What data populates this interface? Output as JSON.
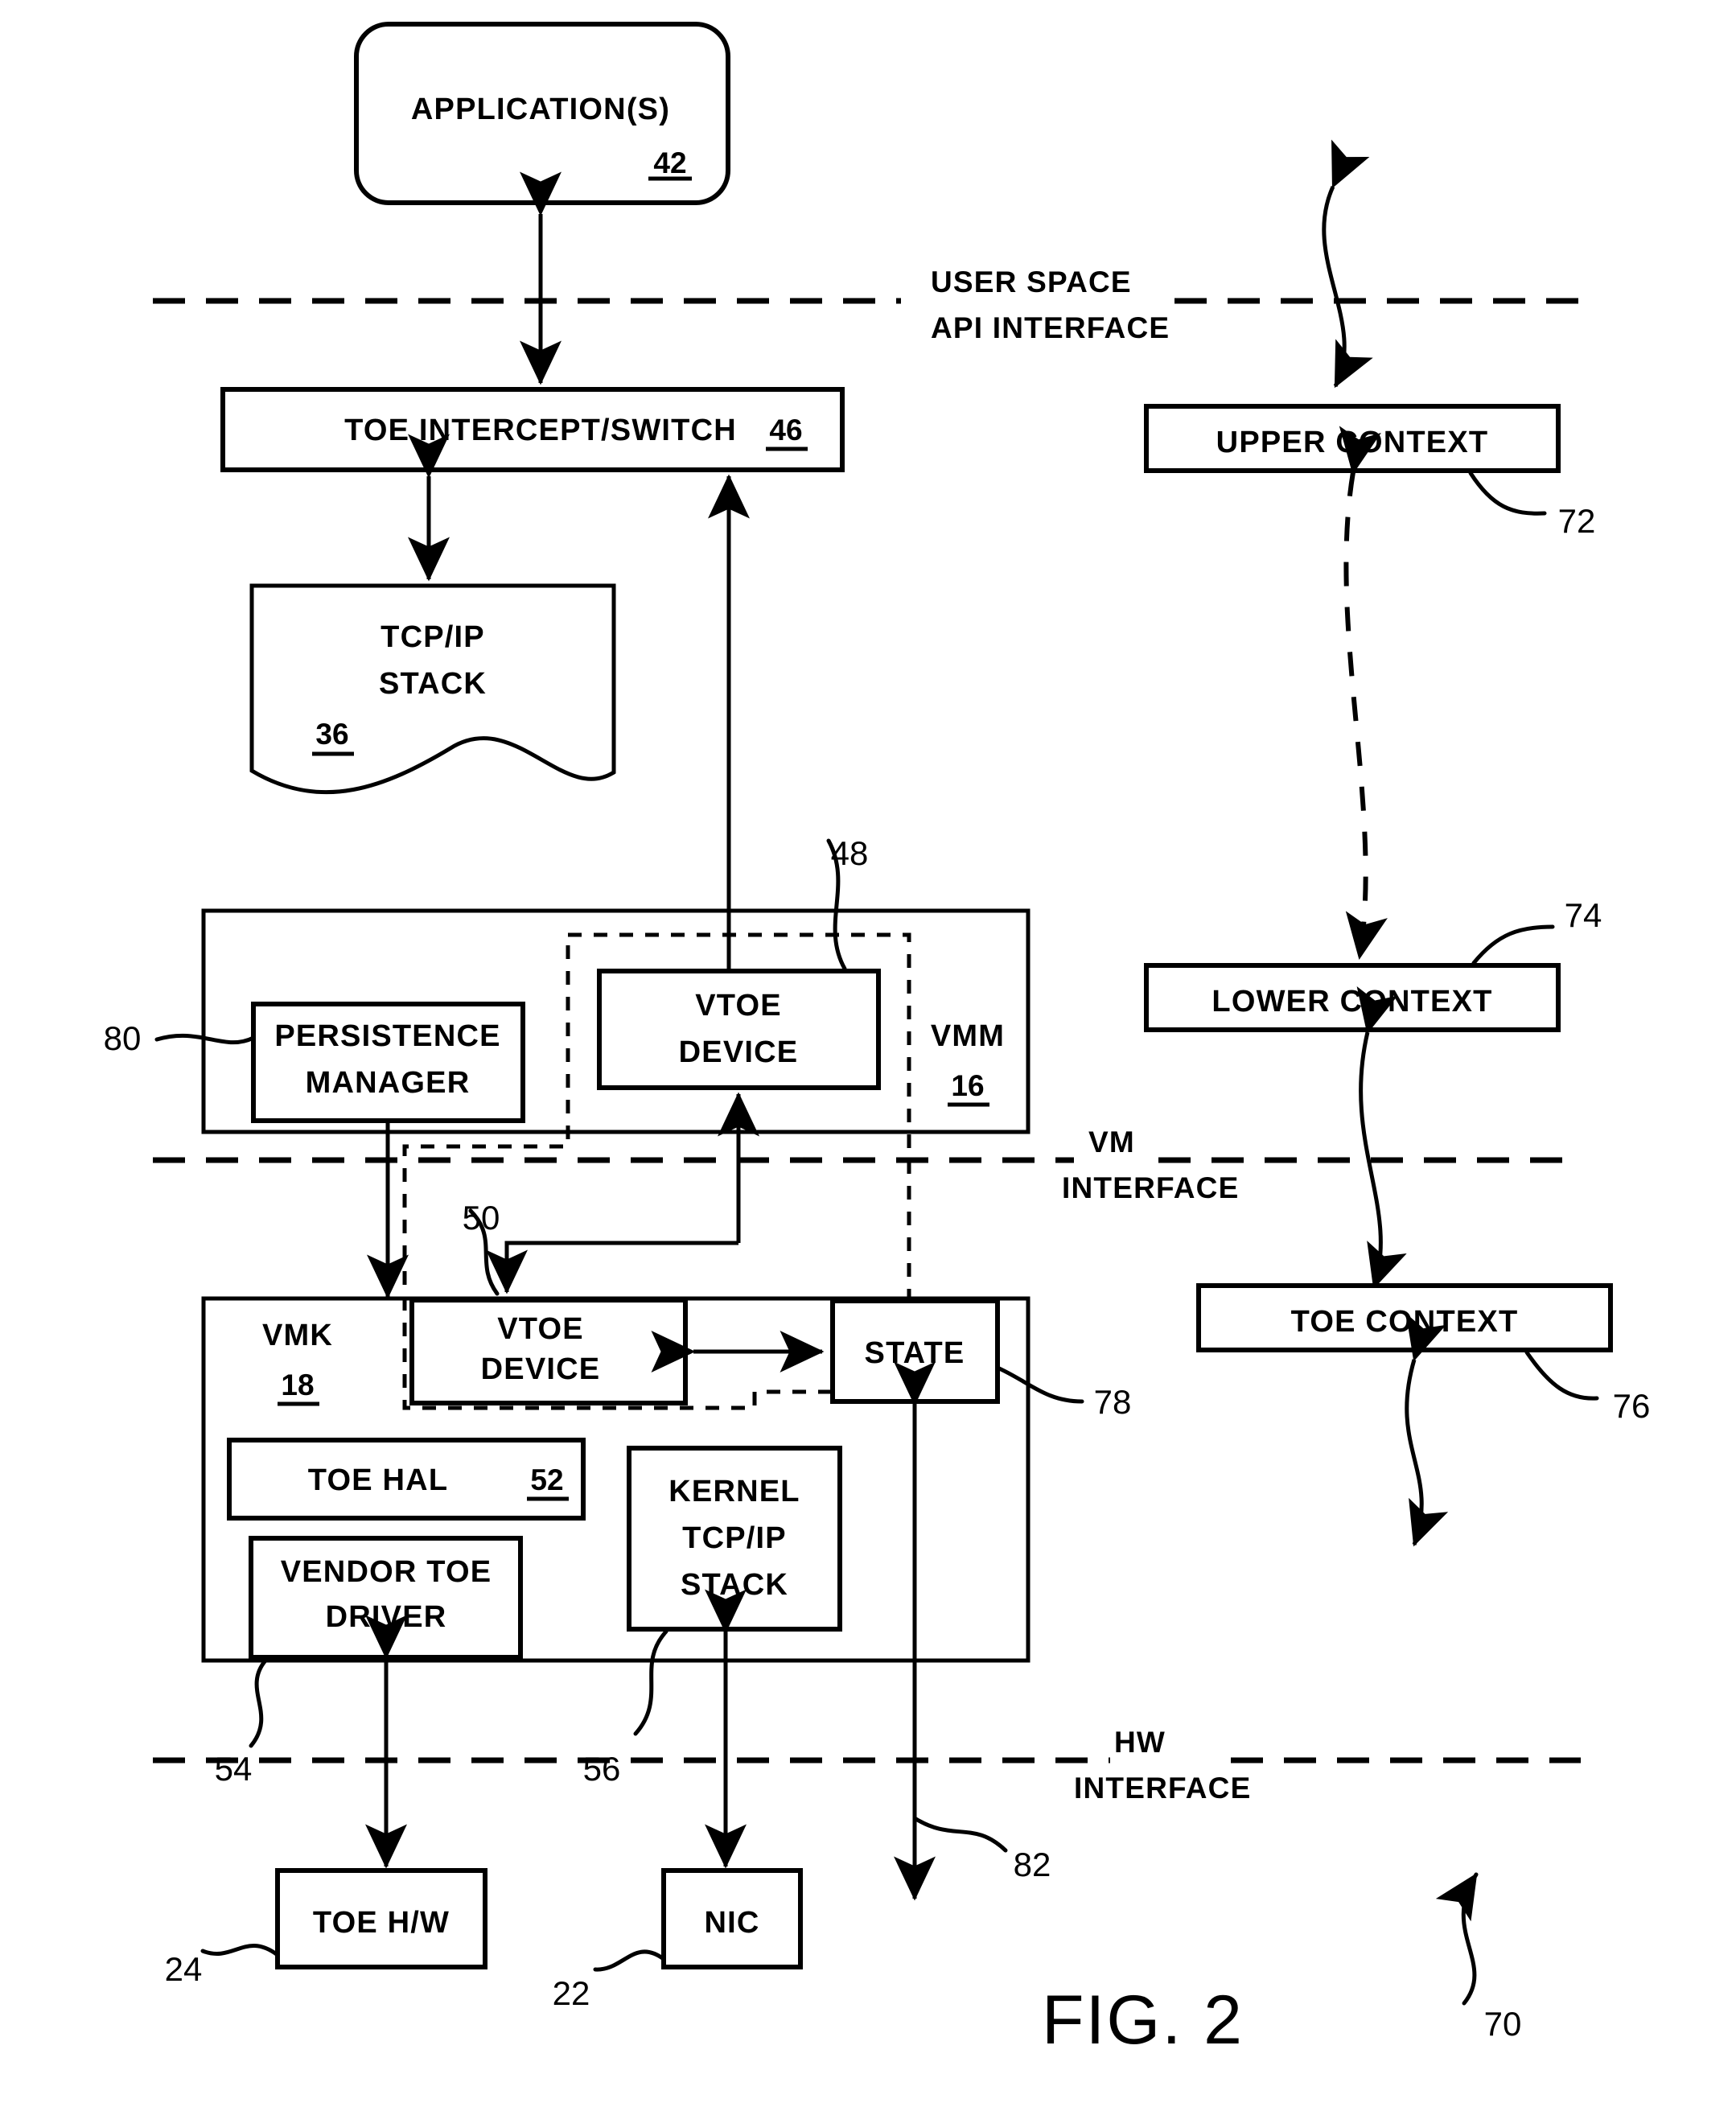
{
  "figure": {
    "label_main": "F",
    "label_rest": "IG",
    "label_full": "FIG. 2",
    "label_small": "IG. 2",
    "label_cap": "F",
    "ref": "70"
  },
  "interfaces": [
    {
      "id": "user-space",
      "line1": "USER SPACE",
      "line2": "API INTERFACE"
    },
    {
      "id": "vm",
      "line1": "VM",
      "line2": "INTERFACE"
    },
    {
      "id": "hw",
      "line1": "HW",
      "line2": "INTERFACE"
    }
  ],
  "blocks": {
    "application": {
      "label": "APPLICATION(S)",
      "ref": "42"
    },
    "toe_intercept": {
      "label": "TOE INTERCEPT/SWITCH",
      "ref": "46"
    },
    "tcpip_stack": {
      "line1": "TCP/IP",
      "line2": "STACK",
      "ref": "36"
    },
    "persistence_mgr": {
      "line1": "PERSISTENCE",
      "line2": "MANAGER",
      "ref": "80"
    },
    "vtoe_device_vmm": {
      "line1": "VTOE",
      "line2": "DEVICE",
      "ref": "48"
    },
    "vmm": {
      "label": "VMM",
      "ref": "16"
    },
    "vtoe_device_vmk": {
      "line1": "VTOE",
      "line2": "DEVICE",
      "ref": "50"
    },
    "vmk": {
      "label": "VMK",
      "ref": "18"
    },
    "state": {
      "label": "STATE",
      "ref": "78"
    },
    "toe_hal": {
      "label": "TOE HAL",
      "ref": "52"
    },
    "vendor_toe_driver": {
      "line1": "VENDOR TOE",
      "line2": "DRIVER",
      "ref": "54"
    },
    "kernel_tcpip": {
      "line1": "KERNEL",
      "line2": "TCP/IP",
      "line3": "STACK",
      "ref": "56"
    },
    "toe_hw": {
      "label": "TOE H/W",
      "ref": "24"
    },
    "nic": {
      "label": "NIC",
      "ref": "22"
    },
    "upper_context": {
      "label": "UPPER CONTEXT",
      "ref": "72"
    },
    "lower_context": {
      "label": "LOWER CONTEXT",
      "ref": "74"
    },
    "toe_context": {
      "label": "TOE CONTEXT",
      "ref": "76"
    },
    "hw_state_link": {
      "ref": "82"
    }
  },
  "colors": {
    "ink": "#000000",
    "paper": "#ffffff"
  }
}
